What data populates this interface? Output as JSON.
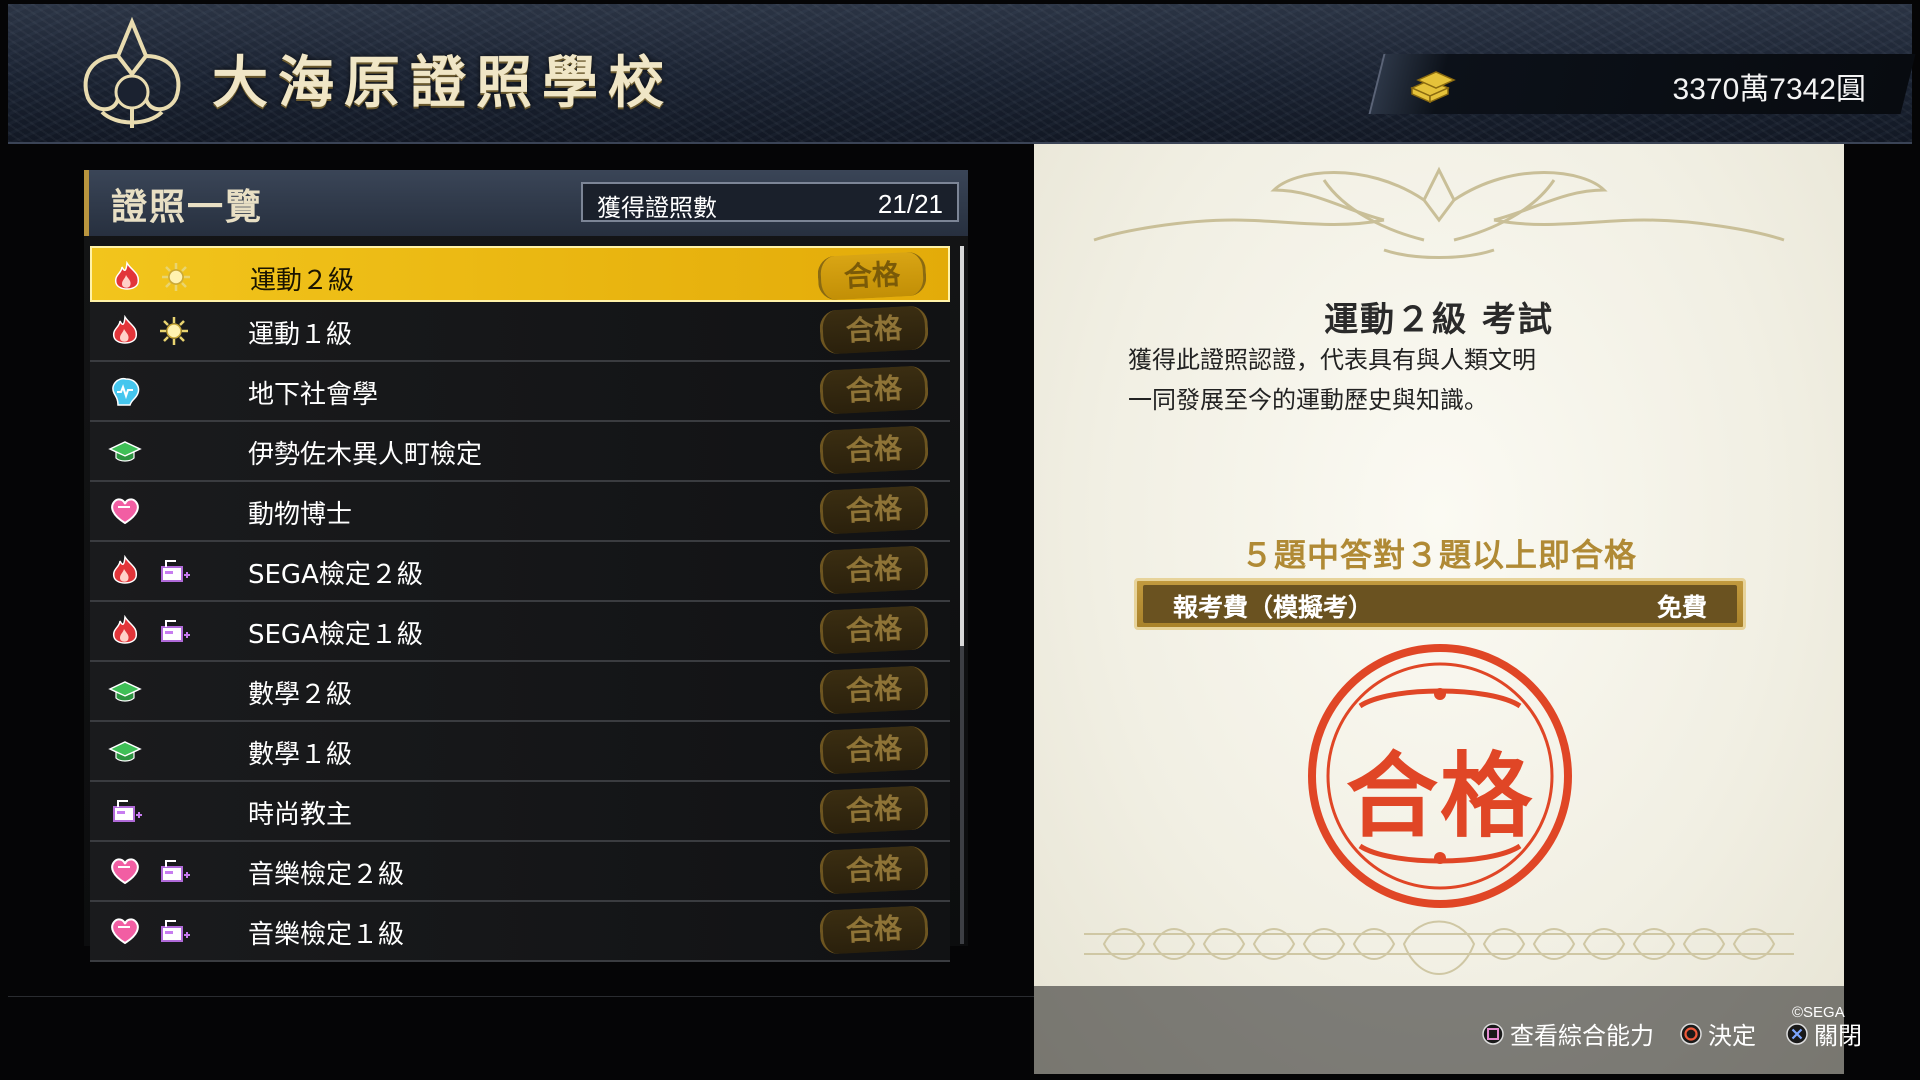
{
  "header": {
    "school_name": "大海原證照學校",
    "money": "3370萬7342圓"
  },
  "list": {
    "title": "證照一覽",
    "count_label": "獲得證照數",
    "count_value": "21/21",
    "pass_label": "合格",
    "items": [
      {
        "name": "運動２級",
        "icons": [
          "fire-icon",
          "sun-icon"
        ],
        "selected": true
      },
      {
        "name": "運動１級",
        "icons": [
          "fire-icon",
          "sun-icon"
        ]
      },
      {
        "name": "地下社會學",
        "icons": [
          "brain-icon"
        ]
      },
      {
        "name": "伊勢佐木異人町檢定",
        "icons": [
          "mortarboard-icon"
        ]
      },
      {
        "name": "動物博士",
        "icons": [
          "heart-icon"
        ]
      },
      {
        "name": "SEGA檢定２級",
        "icons": [
          "fire-icon",
          "style-icon"
        ]
      },
      {
        "name": "SEGA檢定１級",
        "icons": [
          "fire-icon",
          "style-icon"
        ]
      },
      {
        "name": "數學２級",
        "icons": [
          "mortarboard-icon"
        ]
      },
      {
        "name": "數學１級",
        "icons": [
          "mortarboard-icon"
        ]
      },
      {
        "name": "時尚教主",
        "icons": [
          "style-icon"
        ]
      },
      {
        "name": "音樂檢定２級",
        "icons": [
          "heart-icon",
          "style-icon"
        ]
      },
      {
        "name": "音樂檢定１級",
        "icons": [
          "heart-icon",
          "style-icon"
        ]
      }
    ]
  },
  "certificate": {
    "title": "運動２級 考試",
    "description_line1": "獲得此證照認證，代表具有與人類文明",
    "description_line2": "一同發展至今的運動歷史與知識。",
    "condition": "５題中答對３題以上即合格",
    "fee_label": "報考費（模擬考）",
    "fee_value": "免費",
    "stamp_text": "合格"
  },
  "footer": {
    "square_hint": "查看綜合能力",
    "circle_hint": "決定",
    "cross_hint": "關閉",
    "copyright": "©SEGA"
  },
  "colors": {
    "selected_row": "#f2c51c",
    "stamp_red": "#e04626",
    "gold": "#b08a35"
  }
}
